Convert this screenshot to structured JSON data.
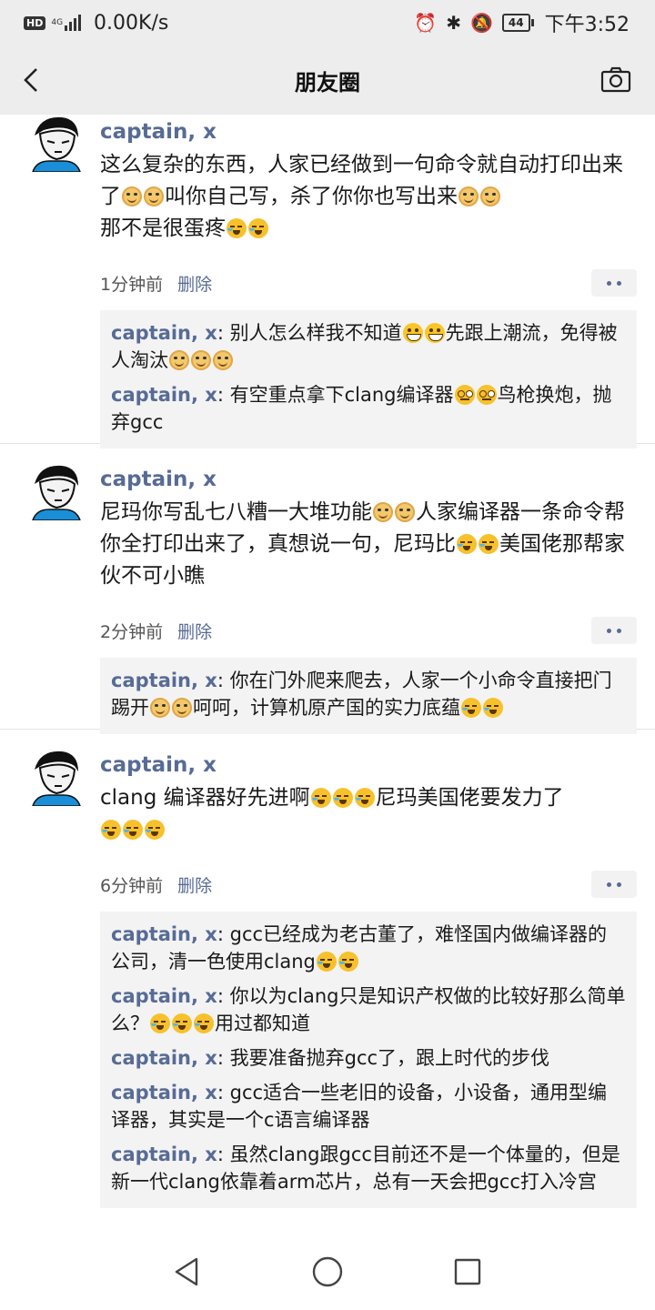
{
  "status_bar": {
    "hd": "HD",
    "network": "4G",
    "speed": "0.00K/s",
    "battery": "44",
    "time": "下午3:52"
  },
  "nav": {
    "title": "朋友圈",
    "back_icon": "back-chevron-icon",
    "camera_icon": "camera-icon"
  },
  "posts": [
    {
      "author": "captain, x",
      "text": [
        "这么复杂的东西，人家已经做到一句命令就自动打印出来了",
        "doge",
        "doge",
        "叫你自己写，杀了你你也写出来",
        "doge",
        "doge",
        "那不是很蛋疼",
        "cry",
        "cry"
      ],
      "time": "1分钟前",
      "delete_label": "删除",
      "comments": [
        {
          "author": "captain, x",
          "text": [
            "别人怎么样我不知道",
            "grin",
            "grin",
            "先跟上潮流，免得被人淘汰",
            "doge",
            "doge",
            "doge"
          ]
        },
        {
          "author": "captain, x",
          "text": [
            "有空重点拿下clang编译器",
            "nerd",
            "nerd",
            "鸟枪换炮，抛弃gcc"
          ]
        }
      ]
    },
    {
      "author": "captain, x",
      "text": [
        "尼玛你写乱七八糟一大堆功能",
        "doge",
        "doge",
        "人家编译器一条命令帮你全打印出来了，真想说一句，尼玛比",
        "cry",
        "cry",
        "美国佬那帮家伙不可小瞧"
      ],
      "time": "2分钟前",
      "delete_label": "删除",
      "comments": [
        {
          "author": "captain, x",
          "text": [
            "你在门外爬来爬去，人家一个小命令直接把门踢开",
            "doge",
            "doge",
            "呵呵，计算机原产国的实力底蕴",
            "cry",
            "cry"
          ]
        }
      ]
    },
    {
      "author": "captain, x",
      "text": [
        "clang 编译器好先进啊",
        "cry",
        "cry",
        "cry",
        "尼玛美国佬要发力了",
        "cry",
        "cry",
        "cry"
      ],
      "time": "6分钟前",
      "delete_label": "删除",
      "comments": [
        {
          "author": "captain, x",
          "text": [
            "gcc已经成为老古董了，难怪国内做编译器的公司，清一色使用clang",
            "cry",
            "cry"
          ]
        },
        {
          "author": "captain, x",
          "text": [
            "你以为clang只是知识产权做的比较好那么简单么？",
            "cry",
            "cry",
            "cry",
            "用过都知道"
          ]
        },
        {
          "author": "captain, x",
          "text": [
            "我要准备抛弃gcc了，跟上时代的步伐"
          ]
        },
        {
          "author": "captain, x",
          "text": [
            "gcc适合一些老旧的设备，小设备，通用型编译器，其实是一个c语言编译器"
          ]
        },
        {
          "author": "captain, x",
          "text": [
            "虽然clang跟gcc目前还不是一个体量的，但是新一代clang依靠着arm芯片，总有一天会把gcc打入冷宫"
          ]
        }
      ]
    }
  ],
  "system_nav": {
    "back_icon": "triangle-back-icon",
    "home_icon": "circle-home-icon",
    "recent_icon": "square-recent-icon"
  }
}
